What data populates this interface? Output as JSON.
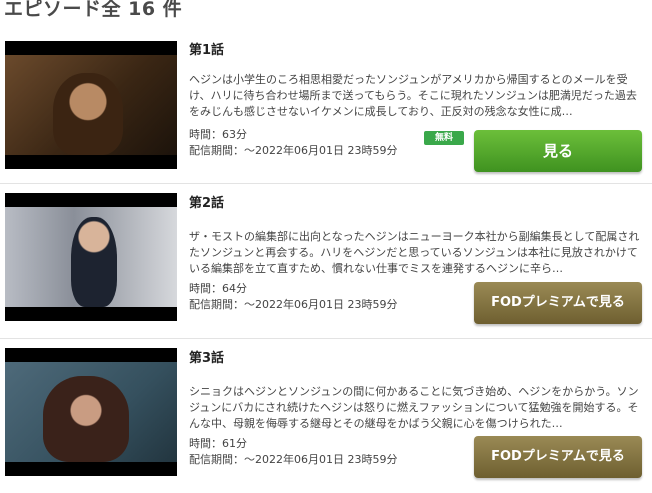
{
  "header": {
    "title": "エピソード全 16 件"
  },
  "episodes": [
    {
      "title": "第1話",
      "description": "ヘジンは小学生のころ相思相愛だったソンジュンがアメリカから帰国するとのメールを受け、ハリに待ち合わせ場所まで送ってもらう。そこに現れたソンジュンは肥満児だった過去をみじんも感じさせないイケメンに成長しており、正反対の残念な女性に成…",
      "duration": "時間：63分",
      "period": "配信期間：～2022年06月01日 23時59分",
      "badge": "無料",
      "button": "見る"
    },
    {
      "title": "第2話",
      "description": "ザ・モストの編集部に出向となったヘジンはニューヨーク本社から副編集長として配属されたソンジュンと再会する。ハリをヘジンだと思っているソンジュンは本社に見放されかけている編集部を立て直すため、慣れない仕事でミスを連発するヘジンに辛ら…",
      "duration": "時間：64分",
      "period": "配信期間：～2022年06月01日 23時59分",
      "button": "FODプレミアムで見る"
    },
    {
      "title": "第3話",
      "description": "シニョクはヘジンとソンジュンの間に何かあることに気づき始め、ヘジンをからかう。ソンジュンにバカにされ続けたヘジンは怒りに燃えファッションについて猛勉強を開始する。そんな中、母親を侮辱する継母とその継母をかばう父親に心を傷つけられた…",
      "duration": "時間：61分",
      "period": "配信期間：～2022年06月01日 23時59分",
      "button": "FODプレミアムで見る"
    }
  ]
}
